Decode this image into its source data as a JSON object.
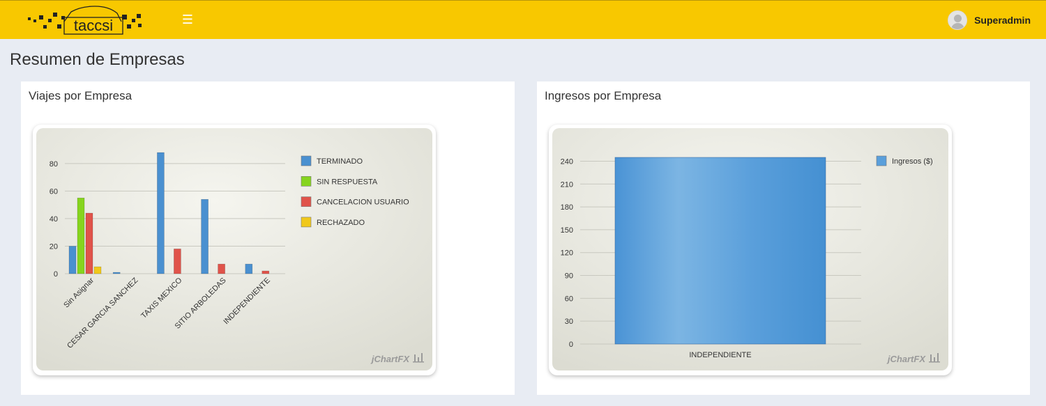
{
  "app": {
    "logo_text": "taccsi",
    "menu_icon": "hamburger-icon",
    "user_name": "Superadmin"
  },
  "page": {
    "title": "Resumen de Empresas"
  },
  "panels": {
    "viajes": {
      "title": "Viajes por Empresa"
    },
    "ingresos": {
      "title": "Ingresos por Empresa"
    }
  },
  "chart_data": [
    {
      "type": "bar",
      "categories": [
        "Sin Asignar",
        "CESAR GARCIA SANCHEZ",
        "TAXIS MEXICO",
        "SITIO ARBOLEDAS",
        "INDEPENDIENTE"
      ],
      "series": [
        {
          "name": "TERMINADO",
          "color": "#4a90d0",
          "values": [
            20,
            1,
            88,
            54,
            7
          ]
        },
        {
          "name": "SIN RESPUESTA",
          "color": "#86d41e",
          "values": [
            55,
            0,
            0,
            0,
            0
          ]
        },
        {
          "name": "CANCELACION USUARIO",
          "color": "#e0534a",
          "values": [
            44,
            0,
            18,
            7,
            2
          ]
        },
        {
          "name": "RECHAZADO",
          "color": "#f0c81a",
          "values": [
            5,
            0,
            0,
            0,
            0
          ]
        }
      ],
      "yticks": [
        0,
        20,
        40,
        60,
        80
      ],
      "ylim": [
        0,
        88
      ],
      "legend": "right",
      "grid": true,
      "brand": "jChartFX"
    },
    {
      "type": "bar",
      "categories": [
        "INDEPENDIENTE"
      ],
      "series": [
        {
          "name": "Ingresos ($)",
          "color": "#5a9fdb",
          "values": [
            245
          ]
        }
      ],
      "yticks": [
        0,
        30,
        60,
        90,
        120,
        150,
        180,
        210,
        240
      ],
      "ylim": [
        0,
        245
      ],
      "legend": "right",
      "grid": true,
      "brand": "jChartFX"
    }
  ]
}
